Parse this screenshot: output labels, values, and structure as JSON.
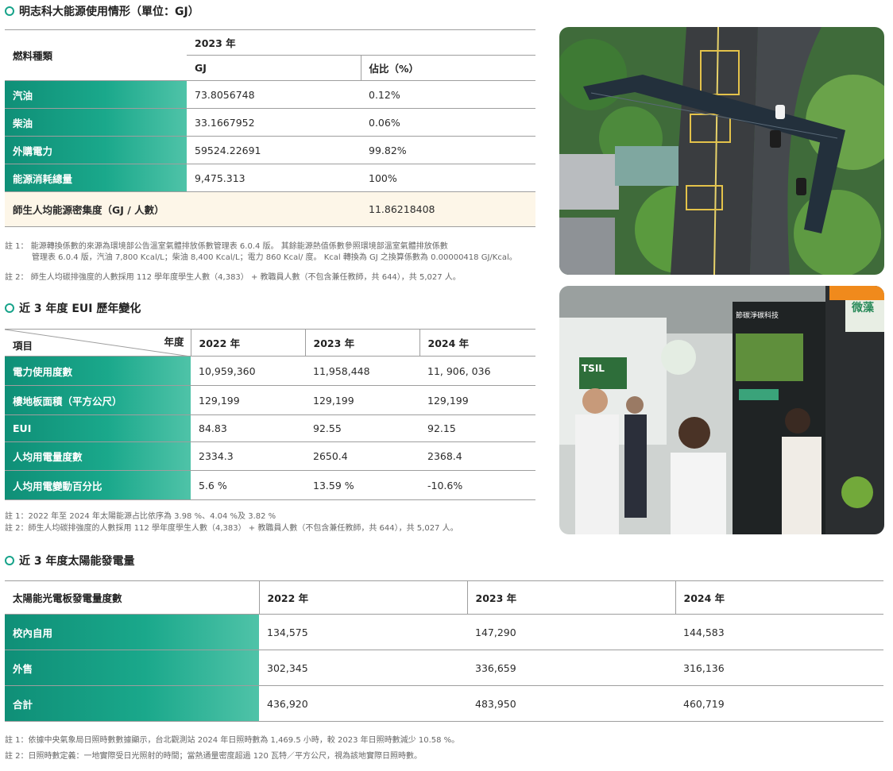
{
  "section1": {
    "title": "明志科大能源使用情形（單位：GJ）",
    "col_fuel": "燃料種類",
    "col_year": "2023 年",
    "col_gj": "GJ",
    "col_pct": "佔比（%）",
    "rows": [
      {
        "label": "汽油",
        "gj": "73.8056748",
        "pct": "0.12%"
      },
      {
        "label": "柴油",
        "gj": "33.1667952",
        "pct": "0.06%"
      },
      {
        "label": "外購電力",
        "gj": "59524.22691",
        "pct": "99.82%"
      },
      {
        "label": "能源消耗總量",
        "gj": "9,475.313",
        "pct": "100%"
      }
    ],
    "intensity_label": "師生人均能源密集度（GJ / 人數）",
    "intensity_value": "11.86218408",
    "note1a": "註 1：  能源轉換係數的來源為環境部公告溫室氣體排放係數管理表 6.0.4 版。 其餘能源熱值係數參照環境部溫室氣體排放係數",
    "note1b": "管理表 6.0.4 版，汽油 7,800 Kcal/L；柴油 8,400 Kcal/L；電力 860 Kcal/ 度。 Kcal 轉換為 GJ 之換算係數為 0.00000418 GJ/Kcal。",
    "note2": "註 2：  師生人均碳排強度的人數採用 112 學年度學生人數（4,383） + 教職員人數（不包含兼任教師，共 644），共 5,027 人。"
  },
  "section2": {
    "title": "近 3 年度 EUI 歷年變化",
    "corner_year": "年度",
    "corner_item": "項目",
    "years": [
      "2022 年",
      "2023 年",
      "2024 年"
    ],
    "rows": [
      {
        "label": "電力使用度數",
        "values": [
          "10,959,360",
          "11,958,448",
          "11, 906, 036"
        ]
      },
      {
        "label": "樓地板面積（平方公尺）",
        "values": [
          "129,199",
          "129,199",
          "129,199"
        ]
      },
      {
        "label": "EUI",
        "values": [
          "84.83",
          "92.55",
          "92.15"
        ]
      },
      {
        "label": "人均用電量度數",
        "values": [
          "2334.3",
          "2650.4",
          "2368.4"
        ]
      },
      {
        "label": "人均用電變動百分比",
        "values": [
          "5.6 %",
          "13.59 %",
          "-10.6%"
        ]
      }
    ],
    "note1": "註 1：2022 年至 2024 年太陽能源占比依序為 3.98 %、4.04 %及 3.82 %",
    "note2": "註 2：師生人均碳排強度的人數採用 112 學年度學生人數（4,383） + 教職員人數（不包含兼任教師，共 644），共 5,027 人。"
  },
  "section3": {
    "title": "近 3 年度太陽能發電量",
    "header_label": "太陽能光電板發電量度數",
    "years": [
      "2022 年",
      "2023 年",
      "2024 年"
    ],
    "rows": [
      {
        "label": "校內自用",
        "values": [
          "134,575",
          "147,290",
          "144,583"
        ]
      },
      {
        "label": "外售",
        "values": [
          "302,345",
          "336,659",
          "316,136"
        ]
      },
      {
        "label": "合計",
        "values": [
          "436,920",
          "483,950",
          "460,719"
        ]
      }
    ],
    "note1": "註 1：依據中央氣象局日照時數數據顯示，台北觀測站 2024 年日照時數為 1,469.5 小時，較 2023 年日照時數減少 10.58 %。",
    "note2": "註 2：日照時數定義：一地實際受日光照射的時間；當熱通量密度超過 120 瓦特／平方公尺，視為該地實際日照時數。"
  },
  "photo2": {
    "sign_text": "微藻",
    "panel_text": "節碳淨碳科技",
    "booth_text": "TSIL"
  },
  "colors": {
    "accent": "#17a38a",
    "green_start": "#0f8f77",
    "green_end": "#4fc3a8",
    "highlight_row": "#fdf6e8"
  }
}
